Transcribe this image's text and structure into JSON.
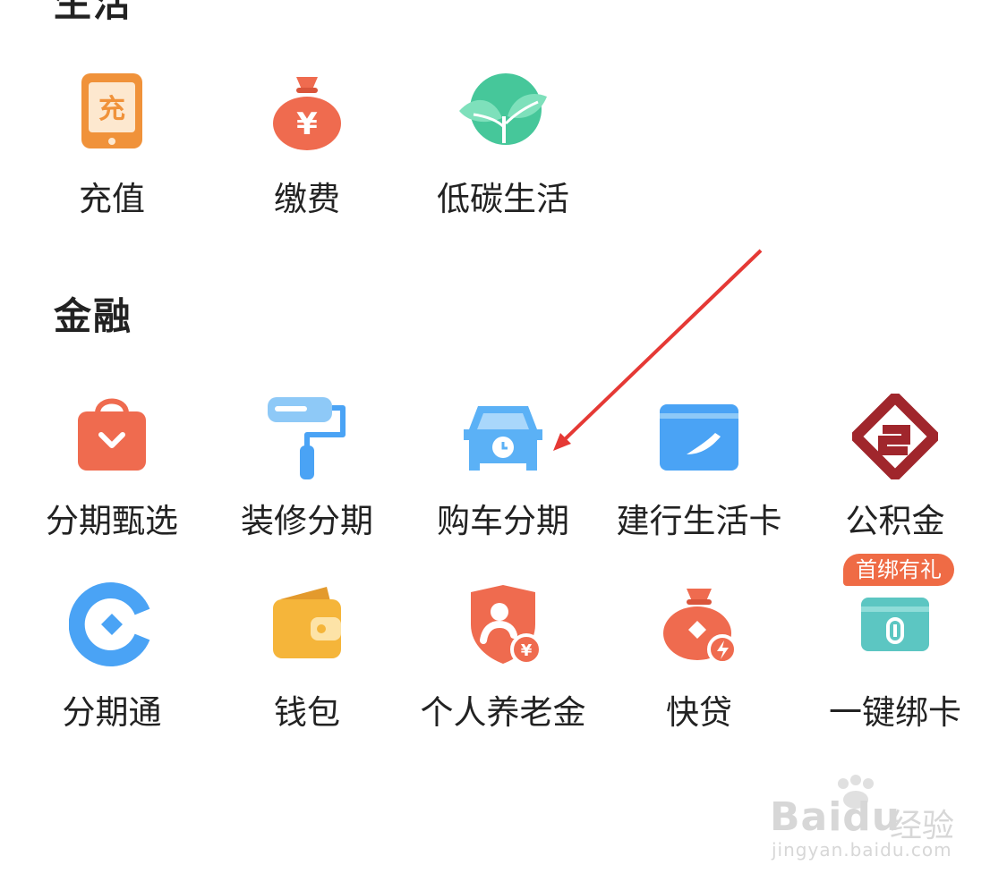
{
  "sections": {
    "life": {
      "title": "生活"
    },
    "finance": {
      "title": "金融"
    }
  },
  "life_items": [
    {
      "label": "充值",
      "icon": "phone-recharge-icon",
      "icon_text": "充"
    },
    {
      "label": "缴费",
      "icon": "money-bag-icon",
      "icon_text": "¥"
    },
    {
      "label": "低碳生活",
      "icon": "leaf-icon"
    }
  ],
  "finance_items": [
    {
      "label": "分期甄选",
      "icon": "shopping-bag-icon"
    },
    {
      "label": "装修分期",
      "icon": "paint-roller-icon"
    },
    {
      "label": "购车分期",
      "icon": "car-icon"
    },
    {
      "label": "建行生活卡",
      "icon": "card-icon"
    },
    {
      "label": "公积金",
      "icon": "housing-fund-icon"
    },
    {
      "label": "分期通",
      "icon": "installment-c-icon"
    },
    {
      "label": "钱包",
      "icon": "wallet-icon"
    },
    {
      "label": "个人养老金",
      "icon": "pension-shield-icon",
      "icon_text": "¥"
    },
    {
      "label": "快贷",
      "icon": "quick-loan-bag-icon"
    },
    {
      "label": "一键绑卡",
      "icon": "bind-card-icon"
    }
  ],
  "badge": {
    "text": "首绑有礼"
  },
  "watermark": {
    "logo": "Baidu",
    "cn": "经验",
    "url": "jingyan.baidu.com"
  },
  "colors": {
    "orange": "#f0923a",
    "red": "#ef6b4f",
    "green": "#46c79a",
    "blue": "#4aa3f5",
    "maroon": "#a0262c",
    "yellow": "#f5b53a",
    "teal": "#5cc6c2",
    "arrow": "#e53935"
  }
}
